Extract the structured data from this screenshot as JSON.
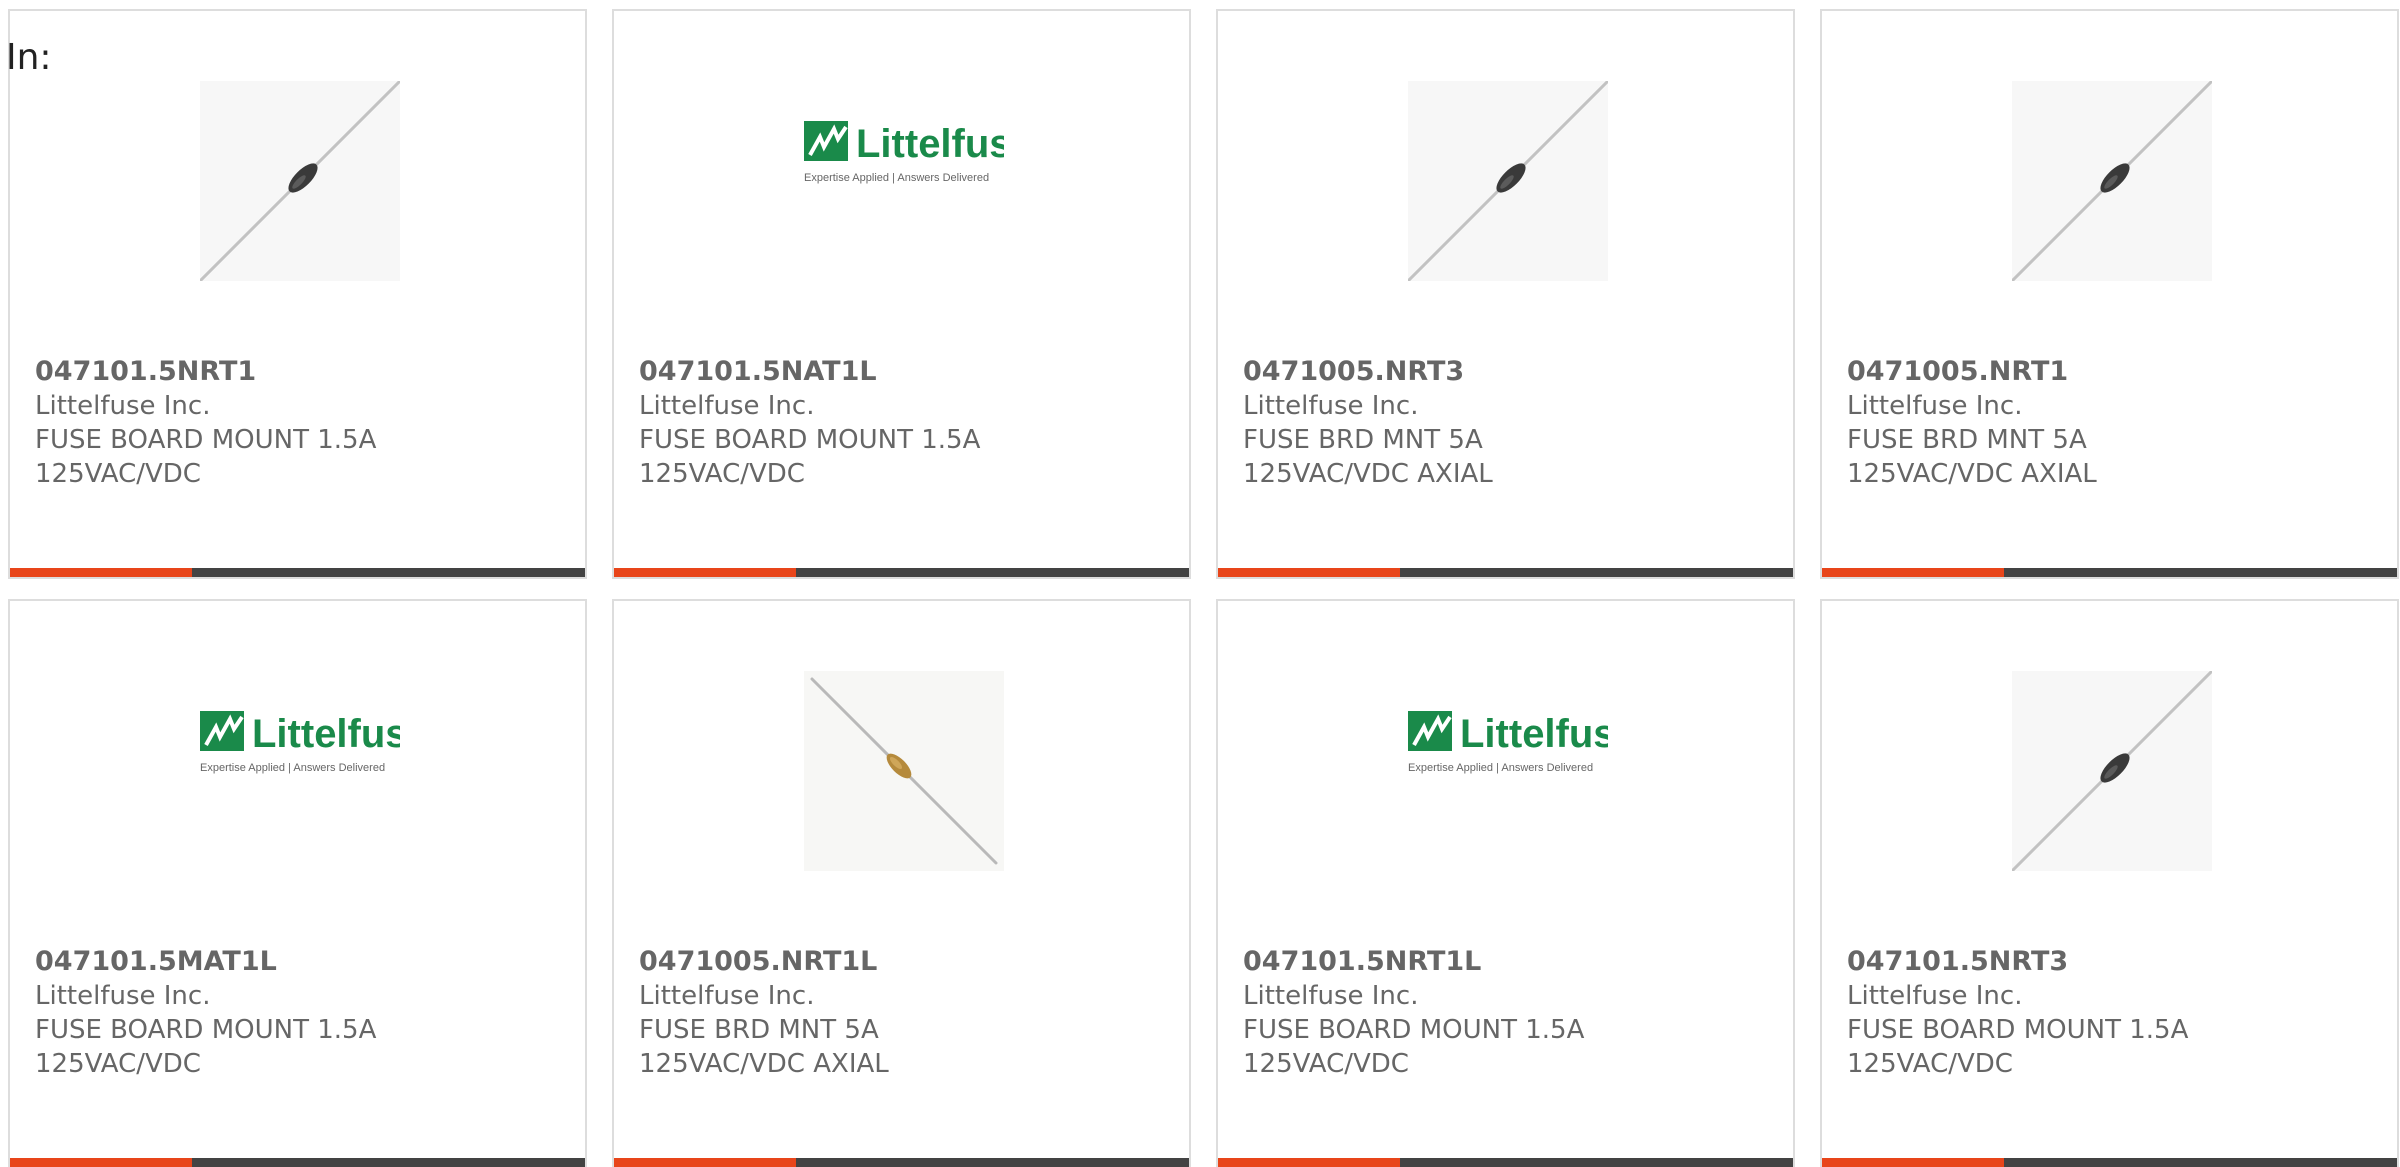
{
  "heading": "In:",
  "colors": {
    "accent": "#e8451a",
    "bar": "#434343",
    "brand_green": "#1a8a4a"
  },
  "logo_text": "Littelfuse",
  "logo_tagline": "Expertise Applied | Answers Delivered",
  "products": [
    {
      "part": "047101.5NRT1",
      "maker": "Littelfuse Inc.",
      "desc": "FUSE BOARD MOUNT 1.5A 125VAC/VDC",
      "image": "fuse-black"
    },
    {
      "part": "047101.5NAT1L",
      "maker": "Littelfuse Inc.",
      "desc": "FUSE BOARD MOUNT 1.5A 125VAC/VDC",
      "image": "logo"
    },
    {
      "part": "0471005.NRT3",
      "maker": "Littelfuse Inc.",
      "desc": "FUSE BRD MNT 5A 125VAC/VDC AXIAL",
      "image": "fuse-black"
    },
    {
      "part": "0471005.NRT1",
      "maker": "Littelfuse Inc.",
      "desc": "FUSE BRD MNT 5A 125VAC/VDC AXIAL",
      "image": "fuse-black"
    },
    {
      "part": "047101.5MAT1L",
      "maker": "Littelfuse Inc.",
      "desc": "FUSE BOARD MOUNT 1.5A 125VAC/VDC",
      "image": "logo"
    },
    {
      "part": "0471005.NRT1L",
      "maker": "Littelfuse Inc.",
      "desc": "FUSE BRD MNT 5A 125VAC/VDC AXIAL",
      "image": "fuse-tan"
    },
    {
      "part": "047101.5NRT1L",
      "maker": "Littelfuse Inc.",
      "desc": "FUSE BOARD MOUNT 1.5A 125VAC/VDC",
      "image": "logo"
    },
    {
      "part": "047101.5NRT3",
      "maker": "Littelfuse Inc.",
      "desc": "FUSE BOARD MOUNT 1.5A 125VAC/VDC",
      "image": "fuse-black"
    }
  ]
}
